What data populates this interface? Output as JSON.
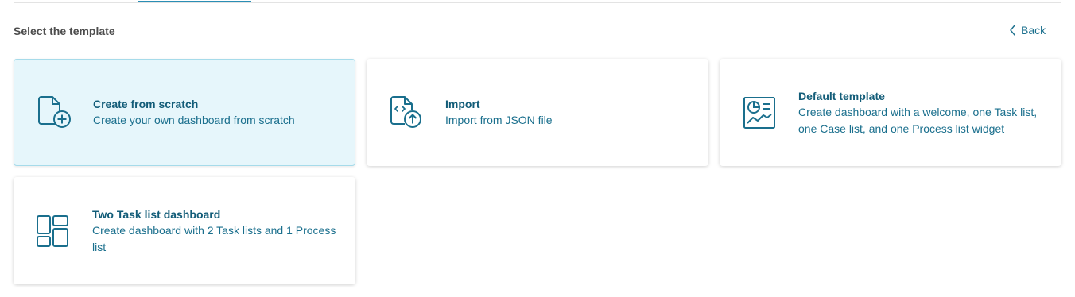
{
  "header": {
    "title": "Select the template",
    "back_label": "Back"
  },
  "templates": [
    {
      "title": "Create from scratch",
      "description": "Create your own dashboard from scratch",
      "icon": "file-add-icon",
      "selected": true
    },
    {
      "title": "Import",
      "description": "Import from JSON file",
      "icon": "file-import-icon",
      "selected": false
    },
    {
      "title": "Default template",
      "description": "Create dashboard with a welcome, one Task list, one Case list, and one Process list widget",
      "icon": "dashboard-report-icon",
      "selected": false
    },
    {
      "title": "Two Task list dashboard",
      "description": "Create dashboard with 2 Task lists and 1 Process list",
      "icon": "layout-grid-icon",
      "selected": false
    }
  ],
  "colors": {
    "accent": "#1a6f8d",
    "selected_background": "#e6f6fb",
    "selected_border": "#a6dbea"
  }
}
